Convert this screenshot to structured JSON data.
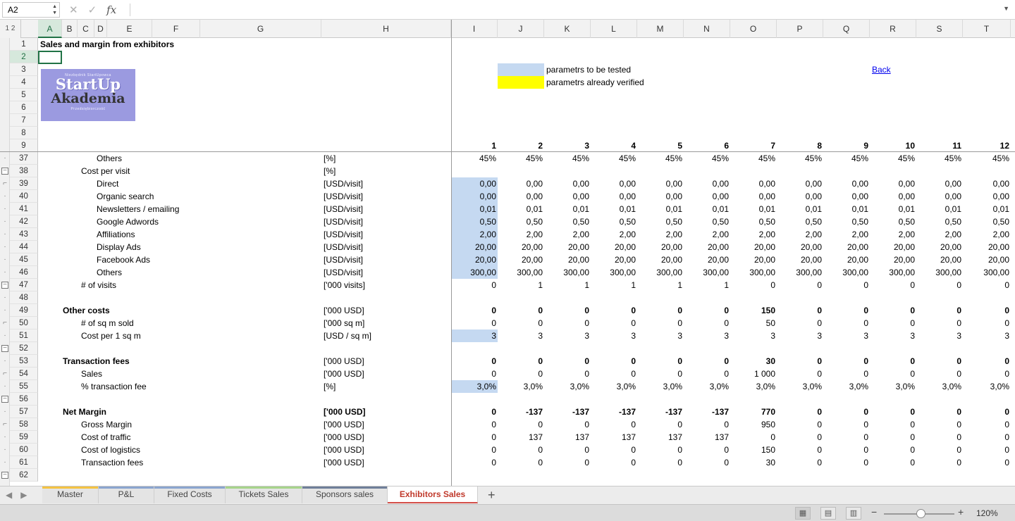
{
  "formula_bar": {
    "name_box": "A2",
    "fx_label": "fx",
    "formula": ""
  },
  "outline_levels": "1 2",
  "columns": [
    "A",
    "B",
    "C",
    "D",
    "E",
    "F",
    "G",
    "H",
    "I",
    "J",
    "K",
    "L",
    "M",
    "N",
    "O",
    "P",
    "Q",
    "R",
    "S",
    "T"
  ],
  "header_rows": {
    "title": "Sales and margin from exhibitors",
    "legend_blue": "parametrs to be tested",
    "legend_yellow": "parametrs already verified",
    "back_link": "Back",
    "logo_small_top": "Niezbędnik StartUpowca",
    "logo_line1": "StartUp",
    "logo_line2": "Akademia",
    "logo_small_bottom": "Przedsiębiorczość",
    "period_numbers": [
      "1",
      "2",
      "3",
      "4",
      "5",
      "6",
      "7",
      "8",
      "9",
      "10",
      "11",
      "12"
    ]
  },
  "top_row_numbers": [
    "1",
    "2",
    "3",
    "4",
    "5",
    "6",
    "7",
    "8",
    "9"
  ],
  "rows": [
    {
      "n": "37",
      "label": "Others",
      "indent": 3,
      "unit": "[%]",
      "bold": false,
      "values": [
        "45%",
        "45%",
        "45%",
        "45%",
        "45%",
        "45%",
        "45%",
        "45%",
        "45%",
        "45%",
        "45%",
        "45%"
      ],
      "first": ""
    },
    {
      "n": "38",
      "label": "Cost per visit",
      "indent": 2,
      "unit": "[%]",
      "bold": false,
      "values": [
        "",
        "",
        "",
        "",
        "",
        "",
        "",
        "",
        "",
        "",
        "",
        ""
      ],
      "first": ""
    },
    {
      "n": "39",
      "label": "Direct",
      "indent": 3,
      "unit": "[USD/visit]",
      "bold": false,
      "values": [
        "0,00",
        "0,00",
        "0,00",
        "0,00",
        "0,00",
        "0,00",
        "0,00",
        "0,00",
        "0,00",
        "0,00",
        "0,00",
        "0,00"
      ],
      "first": "blue"
    },
    {
      "n": "40",
      "label": "Organic search",
      "indent": 3,
      "unit": "[USD/visit]",
      "bold": false,
      "values": [
        "0,00",
        "0,00",
        "0,00",
        "0,00",
        "0,00",
        "0,00",
        "0,00",
        "0,00",
        "0,00",
        "0,00",
        "0,00",
        "0,00"
      ],
      "first": "blue"
    },
    {
      "n": "41",
      "label": "Newsletters / emailing",
      "indent": 3,
      "unit": "[USD/visit]",
      "bold": false,
      "values": [
        "0,01",
        "0,01",
        "0,01",
        "0,01",
        "0,01",
        "0,01",
        "0,01",
        "0,01",
        "0,01",
        "0,01",
        "0,01",
        "0,01"
      ],
      "first": "blue"
    },
    {
      "n": "42",
      "label": "Google Adwords",
      "indent": 3,
      "unit": "[USD/visit]",
      "bold": false,
      "values": [
        "0,50",
        "0,50",
        "0,50",
        "0,50",
        "0,50",
        "0,50",
        "0,50",
        "0,50",
        "0,50",
        "0,50",
        "0,50",
        "0,50"
      ],
      "first": "blue"
    },
    {
      "n": "43",
      "label": "Affiliations",
      "indent": 3,
      "unit": "[USD/visit]",
      "bold": false,
      "values": [
        "2,00",
        "2,00",
        "2,00",
        "2,00",
        "2,00",
        "2,00",
        "2,00",
        "2,00",
        "2,00",
        "2,00",
        "2,00",
        "2,00"
      ],
      "first": "blue"
    },
    {
      "n": "44",
      "label": "Display Ads",
      "indent": 3,
      "unit": "[USD/visit]",
      "bold": false,
      "values": [
        "20,00",
        "20,00",
        "20,00",
        "20,00",
        "20,00",
        "20,00",
        "20,00",
        "20,00",
        "20,00",
        "20,00",
        "20,00",
        "20,00"
      ],
      "first": "blue"
    },
    {
      "n": "45",
      "label": "Facebook Ads",
      "indent": 3,
      "unit": "[USD/visit]",
      "bold": false,
      "values": [
        "20,00",
        "20,00",
        "20,00",
        "20,00",
        "20,00",
        "20,00",
        "20,00",
        "20,00",
        "20,00",
        "20,00",
        "20,00",
        "20,00"
      ],
      "first": "blue"
    },
    {
      "n": "46",
      "label": "Others",
      "indent": 3,
      "unit": "[USD/visit]",
      "bold": false,
      "values": [
        "300,00",
        "300,00",
        "300,00",
        "300,00",
        "300,00",
        "300,00",
        "300,00",
        "300,00",
        "300,00",
        "300,00",
        "300,00",
        "300,00"
      ],
      "first": "blue"
    },
    {
      "n": "47",
      "label": "# of visits",
      "indent": 2,
      "unit": "['000 visits]",
      "bold": false,
      "values": [
        "0",
        "1",
        "1",
        "1",
        "1",
        "1",
        "0",
        "0",
        "0",
        "0",
        "0",
        "0"
      ],
      "first": ""
    },
    {
      "n": "48",
      "label": "",
      "indent": 0,
      "unit": "",
      "bold": false,
      "values": [
        "",
        "",
        "",
        "",
        "",
        "",
        "",
        "",
        "",
        "",
        "",
        ""
      ],
      "first": ""
    },
    {
      "n": "49",
      "label": "Other costs",
      "indent": 1,
      "unit": "['000 USD]",
      "bold": true,
      "values": [
        "0",
        "0",
        "0",
        "0",
        "0",
        "0",
        "150",
        "0",
        "0",
        "0",
        "0",
        "0"
      ],
      "first": ""
    },
    {
      "n": "50",
      "label": "# of sq m sold",
      "indent": 2,
      "unit": "['000 sq m]",
      "bold": false,
      "values": [
        "0",
        "0",
        "0",
        "0",
        "0",
        "0",
        "50",
        "0",
        "0",
        "0",
        "0",
        "0"
      ],
      "first": ""
    },
    {
      "n": "51",
      "label": "Cost per 1 sq m",
      "indent": 2,
      "unit": "[USD / sq m]",
      "bold": false,
      "values": [
        "3",
        "3",
        "3",
        "3",
        "3",
        "3",
        "3",
        "3",
        "3",
        "3",
        "3",
        "3"
      ],
      "first": "blue"
    },
    {
      "n": "52",
      "label": "",
      "indent": 0,
      "unit": "",
      "bold": false,
      "values": [
        "",
        "",
        "",
        "",
        "",
        "",
        "",
        "",
        "",
        "",
        "",
        ""
      ],
      "first": ""
    },
    {
      "n": "53",
      "label": "Transaction fees",
      "indent": 1,
      "unit": "['000 USD]",
      "bold": true,
      "values": [
        "0",
        "0",
        "0",
        "0",
        "0",
        "0",
        "30",
        "0",
        "0",
        "0",
        "0",
        "0"
      ],
      "first": ""
    },
    {
      "n": "54",
      "label": "Sales",
      "indent": 2,
      "unit": "['000 USD]",
      "bold": false,
      "values": [
        "0",
        "0",
        "0",
        "0",
        "0",
        "0",
        "1 000",
        "0",
        "0",
        "0",
        "0",
        "0"
      ],
      "first": ""
    },
    {
      "n": "55",
      "label": "% transaction fee",
      "indent": 2,
      "unit": "[%]",
      "bold": false,
      "values": [
        "3,0%",
        "3,0%",
        "3,0%",
        "3,0%",
        "3,0%",
        "3,0%",
        "3,0%",
        "3,0%",
        "3,0%",
        "3,0%",
        "3,0%",
        "3,0%"
      ],
      "first": "blue"
    },
    {
      "n": "56",
      "label": "",
      "indent": 0,
      "unit": "",
      "bold": false,
      "values": [
        "",
        "",
        "",
        "",
        "",
        "",
        "",
        "",
        "",
        "",
        "",
        ""
      ],
      "first": ""
    },
    {
      "n": "57",
      "label": "Net Margin",
      "indent": 1,
      "unit": "['000 USD]",
      "bold": true,
      "values": [
        "0",
        "-137",
        "-137",
        "-137",
        "-137",
        "-137",
        "770",
        "0",
        "0",
        "0",
        "0",
        "0"
      ],
      "first": ""
    },
    {
      "n": "58",
      "label": "Gross Margin",
      "indent": 2,
      "unit": "['000 USD]",
      "bold": false,
      "values": [
        "0",
        "0",
        "0",
        "0",
        "0",
        "0",
        "950",
        "0",
        "0",
        "0",
        "0",
        "0"
      ],
      "first": ""
    },
    {
      "n": "59",
      "label": "Cost of traffic",
      "indent": 2,
      "unit": "['000 USD]",
      "bold": false,
      "values": [
        "0",
        "137",
        "137",
        "137",
        "137",
        "137",
        "0",
        "0",
        "0",
        "0",
        "0",
        "0"
      ],
      "first": ""
    },
    {
      "n": "60",
      "label": "Cost of logistics",
      "indent": 2,
      "unit": "['000 USD]",
      "bold": false,
      "values": [
        "0",
        "0",
        "0",
        "0",
        "0",
        "0",
        "150",
        "0",
        "0",
        "0",
        "0",
        "0"
      ],
      "first": ""
    },
    {
      "n": "61",
      "label": "Transaction fees",
      "indent": 2,
      "unit": "['000 USD]",
      "bold": false,
      "values": [
        "0",
        "0",
        "0",
        "0",
        "0",
        "0",
        "30",
        "0",
        "0",
        "0",
        "0",
        "0"
      ],
      "first": ""
    },
    {
      "n": "62",
      "label": "",
      "indent": 0,
      "unit": "",
      "bold": false,
      "values": [
        "",
        "",
        "",
        "",
        "",
        "",
        "",
        "",
        "",
        "",
        "",
        ""
      ],
      "first": ""
    }
  ],
  "tabs": [
    {
      "label": "Master",
      "color": "#f5c342",
      "active": false
    },
    {
      "label": "P&L",
      "color": "#8aa5cf",
      "active": false
    },
    {
      "label": "Fixed Costs",
      "color": "#8aa5cf",
      "active": false
    },
    {
      "label": "Tickets Sales",
      "color": "#a7d48a",
      "active": false
    },
    {
      "label": "Sponsors sales",
      "color": "#6f7f99",
      "active": false
    },
    {
      "label": "Exhibitors Sales",
      "color": "#d4504a",
      "active": true
    }
  ],
  "add_sheet": "+",
  "status": {
    "zoom": "120%",
    "zoom_minus": "−",
    "zoom_plus": "+"
  },
  "colors": {
    "param_blue": "#c5d9f1",
    "param_yellow": "#ffff00",
    "selection_green": "#217346"
  }
}
